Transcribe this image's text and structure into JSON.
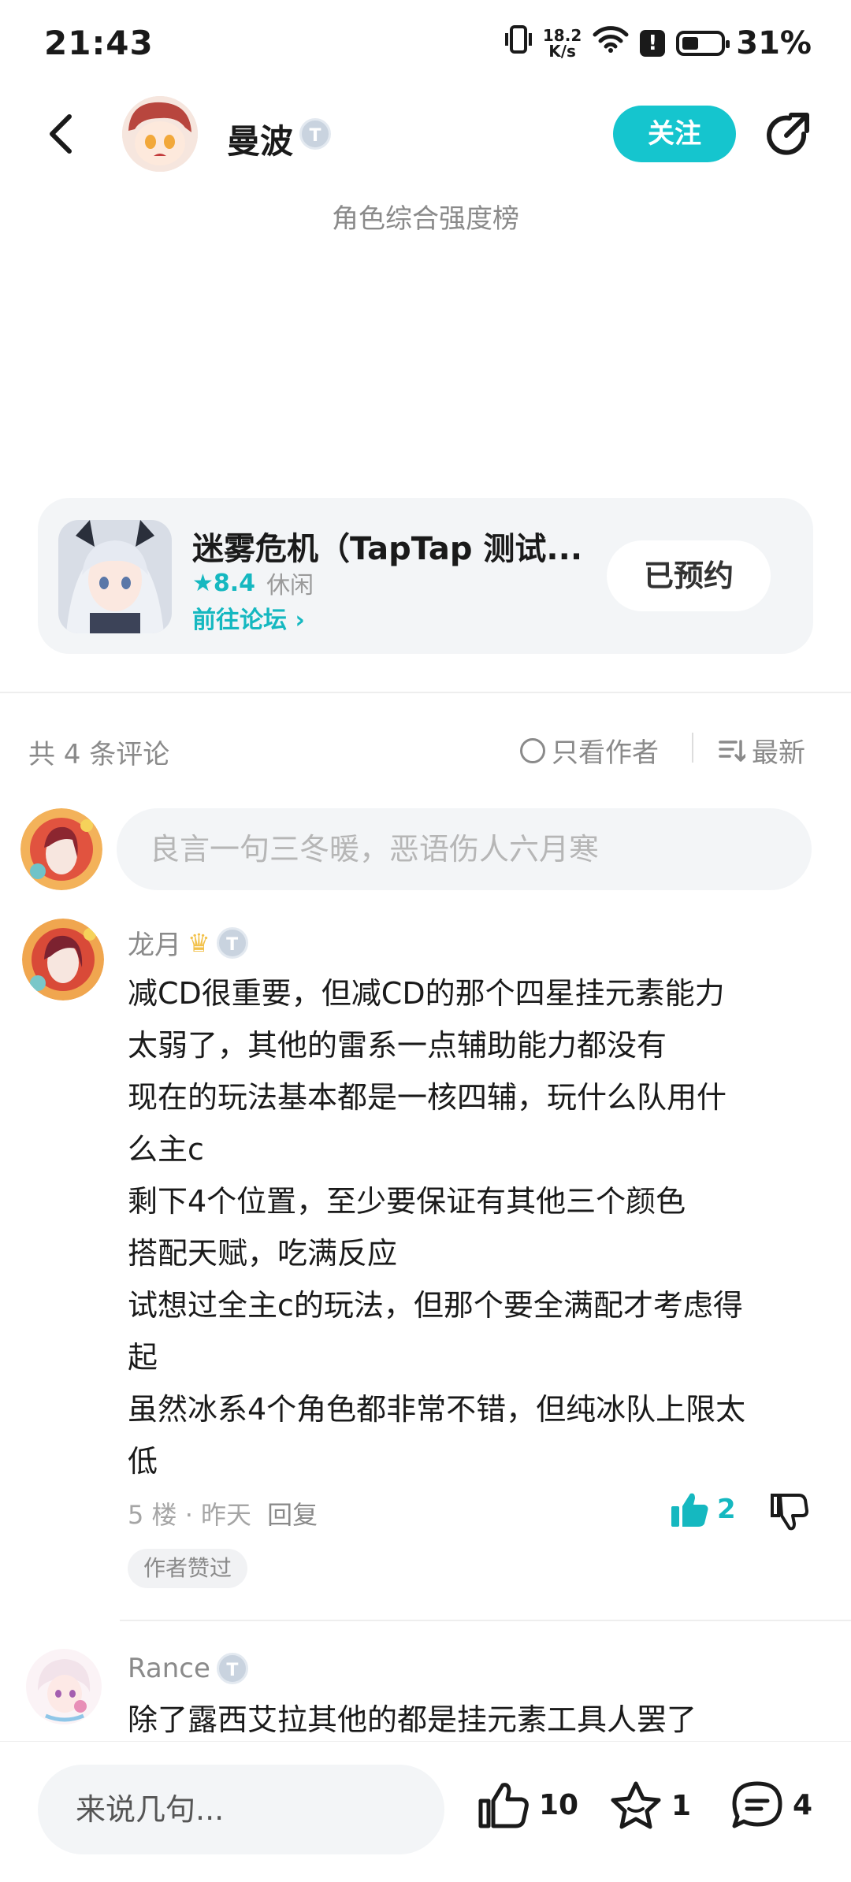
{
  "status_bar": {
    "time": "21:43",
    "net_speed_value": "18.2",
    "net_speed_unit": "K/s",
    "battery": "31%"
  },
  "header": {
    "author": "曼波",
    "author_badge": "T",
    "follow_label": "关注",
    "subtitle": "角色综合强度榜"
  },
  "game_card": {
    "title": "迷雾危机（TapTap 测试...",
    "rating": "8.4",
    "genre": "休闲",
    "forum_link": "前往论坛",
    "reserve_label": "已预约"
  },
  "comments_header": {
    "count_label": "共 4 条评论",
    "only_author_label": "只看作者",
    "sort_label": "最新"
  },
  "comment_input": {
    "placeholder": "良言一句三冬暖，恶语伤人六月寒"
  },
  "comments": [
    {
      "author": "龙月",
      "badge": "T",
      "lines": [
        "减CD很重要，但减CD的那个四星挂元素能力",
        "太弱了，其他的雷系一点辅助能力都没有",
        "现在的玩法基本都是一核四辅，玩什么队用什",
        "么主c",
        "剩下4个位置，至少要保证有其他三个颜色",
        "搭配天赋，吃满反应",
        "试想过全主c的玩法，但那个要全满配才考虑得",
        "起",
        "虽然冰系4个角色都非常不错，但纯冰队上限太",
        "低"
      ],
      "floor": "5 楼 · 昨天",
      "reply_label": "回复",
      "likes": "2",
      "tag": "作者赞过"
    },
    {
      "author": "Rance",
      "badge": "T",
      "lines": [
        "除了露西艾拉其他的都是挂元素工具人罢了"
      ]
    }
  ],
  "bottom_bar": {
    "input_placeholder": "来说几句...",
    "like_count": "10",
    "fav_count": "1",
    "comment_count": "4"
  },
  "colors": {
    "accent": "#15c5ce",
    "accent_text": "#15b8c0",
    "muted": "#8a8a8a"
  }
}
